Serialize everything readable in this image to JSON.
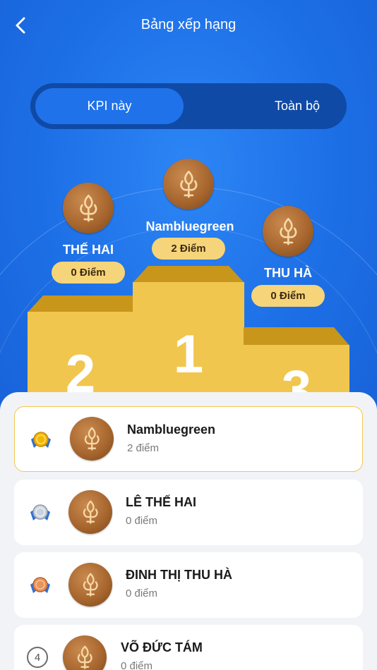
{
  "header": {
    "title": "Bảng xếp hạng",
    "back_icon": "chevron-left-icon"
  },
  "tabs": [
    {
      "label": "KPI này",
      "active": true
    },
    {
      "label": "Toàn bộ",
      "active": false
    }
  ],
  "podium": {
    "first": {
      "name": "Nambluegreen",
      "points": "2 Điểm",
      "rank": "1"
    },
    "second": {
      "name": "THẾ HAI",
      "points": "0 Điểm",
      "rank": "2"
    },
    "third": {
      "name": "THU HÀ",
      "points": "0 Điểm",
      "rank": "3"
    }
  },
  "leaderboard": [
    {
      "rank": "1",
      "name": "Nambluegreen",
      "points": "2 điểm",
      "medal": "gold-medal-icon"
    },
    {
      "rank": "2",
      "name": "LÊ THẾ HAI",
      "points": "0 điểm",
      "medal": "silver-medal-icon"
    },
    {
      "rank": "3",
      "name": "ĐINH THỊ THU HÀ",
      "points": "0 điểm",
      "medal": "bronze-medal-icon"
    },
    {
      "rank": "4",
      "name": "VÕ ĐỨC TÁM",
      "points": "0 điểm",
      "medal": ""
    }
  ],
  "colors": {
    "background": "#1f72ea",
    "podium": "#f1c64f",
    "pill": "#f6d47a",
    "gold": "#f2b705",
    "silver": "#b9c6d3",
    "bronze": "#e8935a"
  }
}
